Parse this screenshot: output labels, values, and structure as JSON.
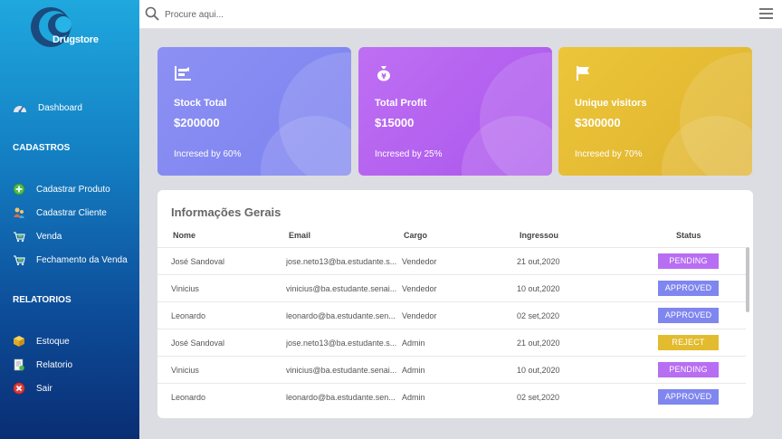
{
  "app": {
    "brand": "Drugstore"
  },
  "search": {
    "placeholder": "Procure aqui..."
  },
  "sidebar": {
    "dashboard": "Dashboard",
    "cadastros_title": "CADASTROS",
    "cadastros": [
      {
        "label": "Cadastrar Produto",
        "icon": "add-product-icon"
      },
      {
        "label": "Cadastrar Cliente",
        "icon": "add-client-icon"
      },
      {
        "label": "Venda",
        "icon": "sale-icon"
      },
      {
        "label": "Fechamento da Venda",
        "icon": "close-sale-icon"
      }
    ],
    "relatorios_title": "RELATORIOS",
    "relatorios": [
      {
        "label": "Estoque",
        "icon": "stock-icon"
      },
      {
        "label": "Relatorio",
        "icon": "report-icon"
      },
      {
        "label": "Sair",
        "icon": "exit-icon"
      }
    ]
  },
  "cards": {
    "stock": {
      "title": "Stock Total",
      "value": "$200000",
      "sub": "Incresed by 60%",
      "color": "#8388f1"
    },
    "profit": {
      "title": "Total Profit",
      "value": "$15000",
      "sub": "Incresed by 25%",
      "color": "#b461f0"
    },
    "visitors": {
      "title": "Unique visitors",
      "value": "$300000",
      "sub": "Incresed by 70%",
      "color": "#e6bd33"
    }
  },
  "table": {
    "title": "Informações Gerais",
    "headers": {
      "nome": "Nome",
      "email": "Email",
      "cargo": "Cargo",
      "ingressou": "Ingressou",
      "status": "Status"
    },
    "rows": [
      {
        "nome": "José Sandoval",
        "email": "jose.neto13@ba.estudante.s...",
        "cargo": "Vendedor",
        "data": "21 out,2020",
        "status": "PENDING"
      },
      {
        "nome": "Vinicius",
        "email": "vinicius@ba.estudante.senai...",
        "cargo": "Vendedor",
        "data": "10 out,2020",
        "status": "APPROVED"
      },
      {
        "nome": "Leonardo",
        "email": "leonardo@ba.estudante.sen...",
        "cargo": "Vendedor",
        "data": "02 set,2020",
        "status": "APPROVED"
      },
      {
        "nome": "José Sandoval",
        "email": "jose.neto13@ba.estudante.s...",
        "cargo": "Admin",
        "data": "21 out,2020",
        "status": "REJECT"
      },
      {
        "nome": "Vinicius",
        "email": "vinicius@ba.estudante.senai...",
        "cargo": "Admin",
        "data": "10 out,2020",
        "status": "PENDING"
      },
      {
        "nome": "Leonardo",
        "email": "leonardo@ba.estudante.sen...",
        "cargo": "Admin",
        "data": "02 set,2020",
        "status": "APPROVED"
      }
    ]
  },
  "status_colors": {
    "PENDING": "#b86ef2",
    "APPROVED": "#7f86ef",
    "REJECT": "#e3bb2e"
  }
}
